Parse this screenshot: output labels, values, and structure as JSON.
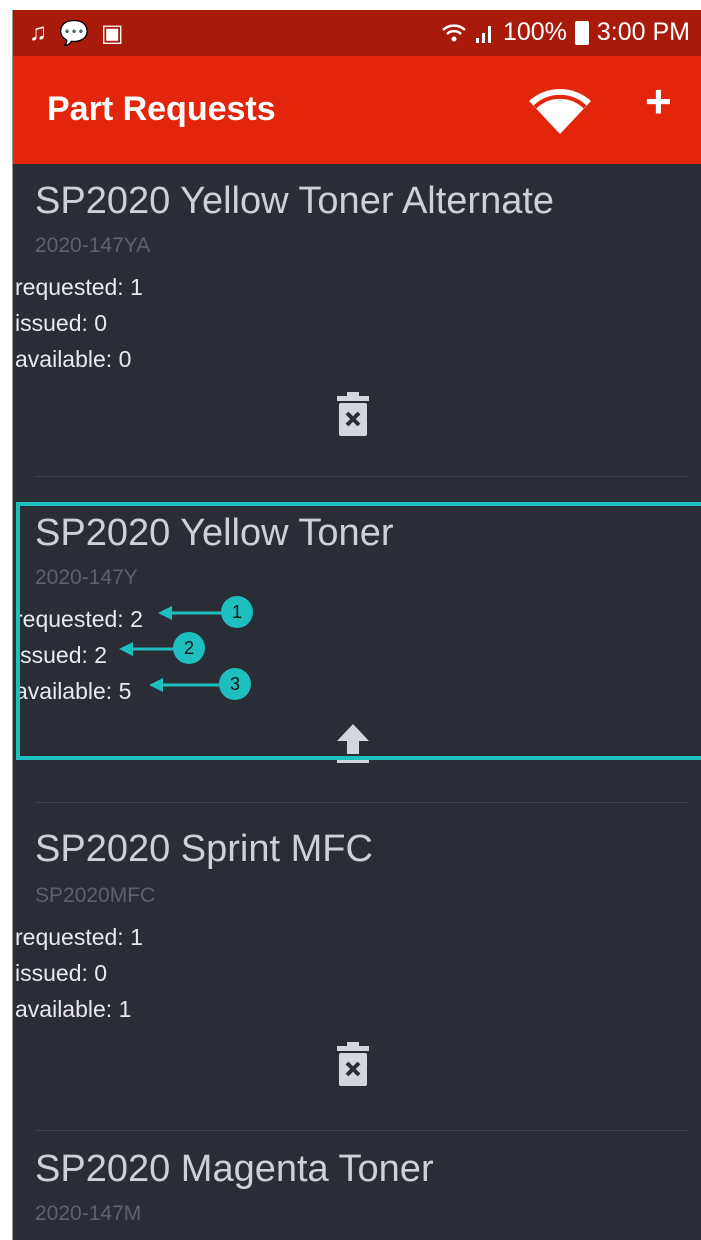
{
  "status_bar": {
    "battery": "100%",
    "time": "3:00 PM"
  },
  "app_bar": {
    "title": "Part Requests",
    "add_label": "+"
  },
  "labels": {
    "requested": "requested: ",
    "issued": "issued: ",
    "available": "available: "
  },
  "items": [
    {
      "name": "SP2020 Yellow Toner Alternate",
      "code": "2020-147YA",
      "requested": "1",
      "issued": "0",
      "available": "0",
      "action_icon": "trash-icon"
    },
    {
      "name": "SP2020 Yellow Toner",
      "code": "2020-147Y",
      "requested": "2",
      "issued": "2",
      "available": "5",
      "action_icon": "upload-icon"
    },
    {
      "name": "SP2020 Sprint MFC",
      "code": "SP2020MFC",
      "requested": "1",
      "issued": "0",
      "available": "1",
      "action_icon": "trash-icon"
    },
    {
      "name": "SP2020 Magenta Toner",
      "code": "2020-147M"
    }
  ],
  "callouts": [
    "1",
    "2",
    "3"
  ],
  "colors": {
    "status_bar": "#a81b0b",
    "app_bar": "#e3260b",
    "background": "#2b2d36",
    "highlight": "#1dbfbf"
  }
}
